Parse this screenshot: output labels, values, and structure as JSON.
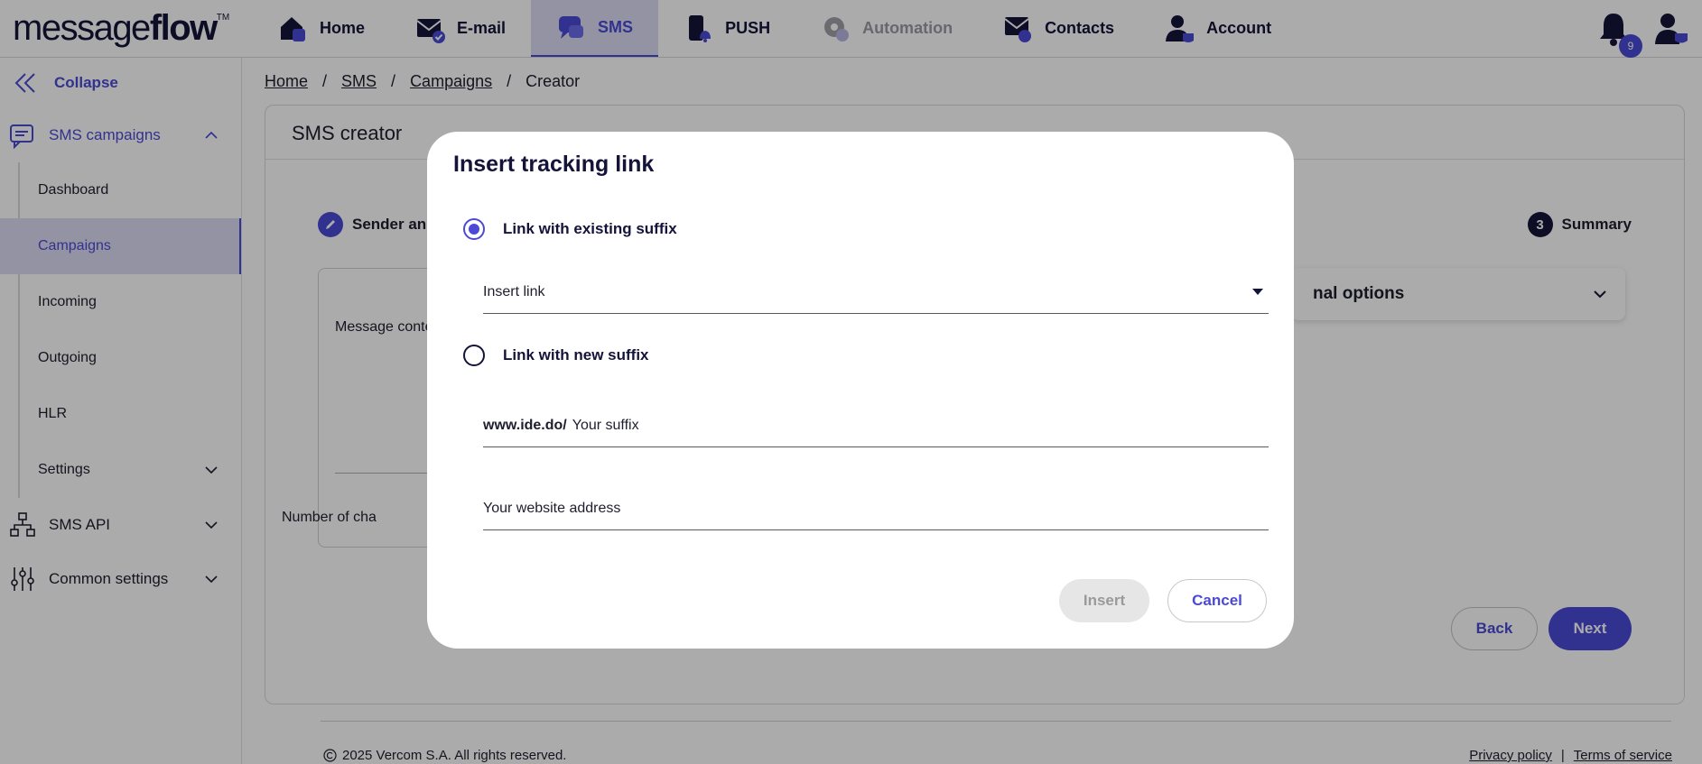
{
  "brand": {
    "logo_light": "message",
    "logo_bold": "flow",
    "logo_tm": "TM"
  },
  "nav": {
    "home": "Home",
    "email": "E-mail",
    "sms": "SMS",
    "push": "PUSH",
    "automation": "Automation",
    "contacts": "Contacts",
    "account": "Account",
    "notif_count": "9"
  },
  "sidebar": {
    "collapse": "Collapse",
    "sms_campaigns": "SMS campaigns",
    "items": [
      "Dashboard",
      "Campaigns",
      "Incoming",
      "Outgoing",
      "HLR",
      "Settings"
    ],
    "sms_api": "SMS API",
    "common_settings": "Common settings"
  },
  "breadcrumb": {
    "home": "Home",
    "sms": "SMS",
    "campaigns": "Campaigns",
    "current": "Creator",
    "sep": "/"
  },
  "creator": {
    "title": "SMS creator",
    "step1_label": "Sender and",
    "step3_num": "3",
    "step3_label": "Summary",
    "message_label": "Message conte",
    "char_count_label": "Number of cha",
    "additional_options": "nal options",
    "back": "Back",
    "next": "Next"
  },
  "footer": {
    "copyright": "2025 Vercom S.A. All rights reserved.",
    "privacy": "Privacy policy",
    "sep": "|",
    "terms": "Terms of service"
  },
  "modal": {
    "title": "Insert tracking link",
    "option_existing": "Link with existing suffix",
    "insert_link_placeholder": "Insert link",
    "option_new": "Link with new suffix",
    "domain_prefix": "www.ide.do/",
    "suffix_placeholder": "Your suffix",
    "website_placeholder": "Your website address",
    "insert": "Insert",
    "cancel": "Cancel"
  },
  "colors": {
    "accent": "#4a4ad6",
    "dark": "#14143a",
    "active_bg": "#dcdcf4"
  }
}
